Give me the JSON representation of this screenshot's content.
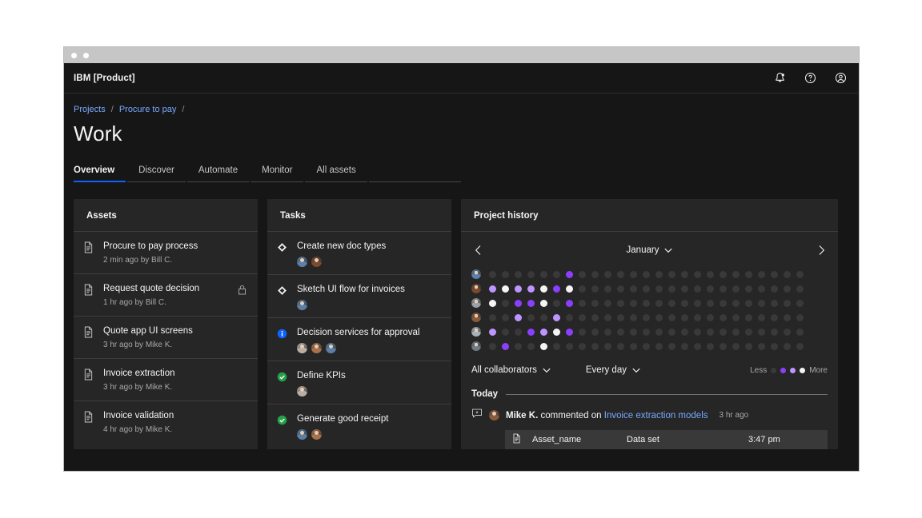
{
  "window": {
    "dots": [
      "close",
      "minimize"
    ]
  },
  "header": {
    "brand_ibm": "IBM",
    "brand_product": "[Product]",
    "icons": [
      "notification-bell-icon",
      "help-icon",
      "user-avatar-icon"
    ]
  },
  "breadcrumb": {
    "items": [
      "Projects",
      "Procure to pay"
    ],
    "separator": "/"
  },
  "page_title": "Work",
  "tabs": [
    {
      "label": "Overview",
      "active": true
    },
    {
      "label": "Discover",
      "active": false
    },
    {
      "label": "Automate",
      "active": false
    },
    {
      "label": "Monitor",
      "active": false
    },
    {
      "label": "All assets",
      "active": false
    }
  ],
  "assets": {
    "title": "Assets",
    "items": [
      {
        "name": "Procure to pay process",
        "meta": "2 min ago by Bill C.",
        "locked": false
      },
      {
        "name": "Request quote decision",
        "meta": "1 hr ago by Bill C.",
        "locked": true
      },
      {
        "name": "Quote app UI screens",
        "meta": "3 hr ago by Mike K.",
        "locked": false
      },
      {
        "name": "Invoice extraction",
        "meta": "3 hr ago by Mike K.",
        "locked": false
      },
      {
        "name": "Invoice validation",
        "meta": "4 hr ago by Mike K.",
        "locked": false
      }
    ]
  },
  "tasks": {
    "title": "Tasks",
    "items": [
      {
        "name": "Create new doc types",
        "status": "diamond",
        "avatars": 2
      },
      {
        "name": "Sketch UI flow for invoices",
        "status": "diamond",
        "avatars": 1
      },
      {
        "name": "Decision services for approval",
        "status": "info",
        "avatars": 3
      },
      {
        "name": "Define KPIs",
        "status": "complete",
        "avatars": 1
      },
      {
        "name": "Generate good receipt",
        "status": "complete",
        "avatars": 2
      }
    ]
  },
  "history": {
    "title": "Project history",
    "month": "January",
    "prev_label": "Previous month",
    "next_label": "Next month",
    "filters": [
      {
        "label": "All collaborators"
      },
      {
        "label": "Every day"
      }
    ],
    "legend": {
      "less": "Less",
      "more": "More"
    },
    "today_label": "Today",
    "feed": [
      {
        "actor": "Mike K.",
        "verb": "commented on",
        "target": "Invoice extraction models",
        "time": "3 hr ago",
        "card": {
          "name": "Asset_name",
          "type": "Data set",
          "time": "3:47 pm"
        }
      }
    ]
  },
  "chart_data": {
    "type": "heatmap",
    "title": "Project history",
    "month": "January",
    "rows": 6,
    "columns": 27,
    "legend_levels": [
      "none",
      "low",
      "medium",
      "high",
      "highest"
    ],
    "level_colors": [
      "#393939",
      "#6929c4",
      "#8a3ffc",
      "#be95ff",
      "#f4f4f4"
    ],
    "matrix": [
      [
        0,
        0,
        0,
        0,
        0,
        0,
        2,
        0,
        0,
        0,
        0,
        0,
        0,
        0,
        0,
        0,
        0,
        0,
        0,
        0,
        0,
        0,
        0,
        0,
        0,
        0,
        0
      ],
      [
        3,
        4,
        3,
        3,
        4,
        2,
        4,
        0,
        0,
        0,
        0,
        0,
        0,
        0,
        0,
        0,
        0,
        0,
        0,
        0,
        0,
        0,
        0,
        0,
        0,
        0,
        0
      ],
      [
        4,
        0,
        2,
        2,
        4,
        0,
        2,
        0,
        0,
        0,
        0,
        0,
        0,
        0,
        0,
        0,
        0,
        0,
        0,
        0,
        0,
        0,
        0,
        0,
        0,
        0,
        0
      ],
      [
        0,
        0,
        3,
        0,
        0,
        3,
        0,
        0,
        0,
        0,
        0,
        0,
        0,
        0,
        0,
        0,
        0,
        0,
        0,
        0,
        0,
        0,
        0,
        0,
        0,
        0,
        0
      ],
      [
        3,
        0,
        0,
        2,
        3,
        4,
        2,
        0,
        0,
        0,
        0,
        0,
        0,
        0,
        0,
        0,
        0,
        0,
        0,
        0,
        0,
        0,
        0,
        0,
        0,
        0,
        0
      ],
      [
        0,
        2,
        0,
        0,
        4,
        0,
        0,
        0,
        0,
        0,
        0,
        0,
        0,
        0,
        0,
        0,
        0,
        0,
        0,
        0,
        0,
        0,
        0,
        0,
        0,
        0,
        0
      ]
    ]
  },
  "avatars": {
    "heatmap": [
      "#5b7fa6",
      "#7a4a2e",
      "#9aa0a8",
      "#8a5a3c",
      "#a8b0b8",
      "#6e7b86"
    ],
    "tasks": [
      [
        "#5b7fa6",
        "#7a4a2e"
      ],
      [
        "#5b7fa6"
      ],
      [
        "#b8aea4",
        "#a8714a",
        "#5b7fa6"
      ],
      [
        "#b8aea4"
      ],
      [
        "#5b7fa6",
        "#a8714a"
      ]
    ],
    "feed": "#8a5a3c"
  }
}
